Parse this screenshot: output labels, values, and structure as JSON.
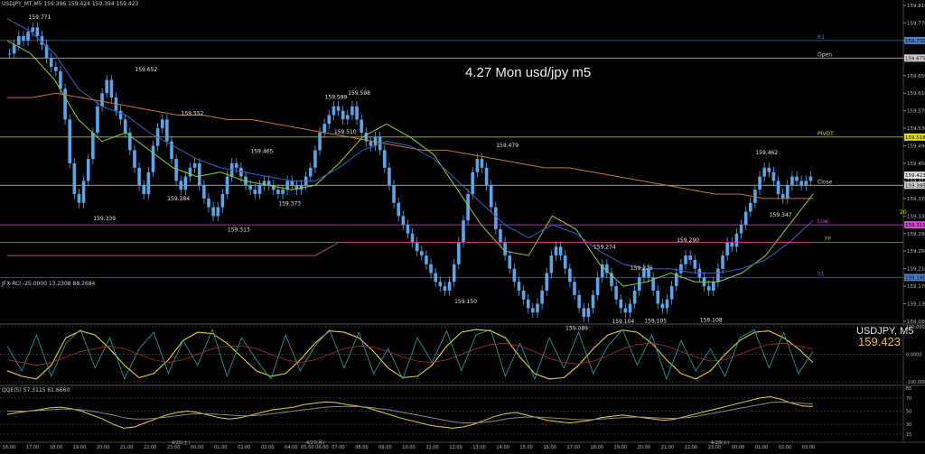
{
  "window": {
    "symbol_header": "USDJPY_MT,M5  159.396 159.424 159.394 159.423",
    "title": "4.27 Mon usd/jpy m5"
  },
  "colors": {
    "background": "#000000",
    "candle": "#5aa6e8",
    "pivot": "#e0e020",
    "r1": "#4d7ec8",
    "s1": "#4d7ec8",
    "open": "#cfcfcf",
    "low": "#d24ad2",
    "pp": "#7ac23a",
    "ma_orange": "#c87a2a",
    "ma_green": "#8ccf3a",
    "ma_blue": "#3a5fc8",
    "ma_pink": "#b0487e",
    "rci_yellow": "#e8d03a",
    "rci_teal": "#2aa6a6",
    "rci_red": "#b03030",
    "qqe_yellow": "#e8d03a"
  },
  "chart_data": [
    {
      "type": "candlestick",
      "title": "4.27 Mon usd/jpy m5",
      "ylim": [
        159.09,
        159.81
      ],
      "y_ticks": [
        "159.810",
        "159.770",
        "159.730",
        "159.690",
        "159.650",
        "159.610",
        "159.570",
        "159.530",
        "159.490",
        "159.450",
        "159.410",
        "159.370",
        "159.330",
        "159.290",
        "159.250",
        "159.210",
        "159.170",
        "159.130",
        "159.090"
      ],
      "x_ticks": [
        "16:00",
        "17:00",
        "18:00",
        "19:00",
        "20:00",
        "21:00",
        "22:00",
        "23:00",
        "00:00",
        "01:00",
        "02:00",
        "03:00",
        "04:00",
        "05:00 06:00",
        "07:00",
        "08:00",
        "09:00",
        "10:00",
        "11:00",
        "12:00",
        "13:00",
        "14:00",
        "15:00",
        "16:00",
        "17:00",
        "18:00",
        "19:00",
        "20:00",
        "21:00",
        "22:00",
        "23:00",
        "00:00",
        "01:00",
        "02:00",
        "03:00"
      ],
      "date_labels": [
        "4/25(土)",
        "4/27(月)",
        "4/28(火)"
      ],
      "levels": [
        {
          "name": "R1",
          "value": 159.73,
          "badge": "159.732"
        },
        {
          "name": "Open",
          "value": 159.69,
          "badge": "159.675"
        },
        {
          "name": "PIVOT",
          "value": 159.51,
          "badge": "159.518"
        },
        {
          "name": "Close",
          "value": 159.4,
          "badge": "159.395"
        },
        {
          "name": "Low",
          "value": 159.31,
          "badge": "159.313"
        },
        {
          "name": "PP",
          "value": 159.27
        },
        {
          "name": "S1",
          "value": 159.19,
          "badge": "159.190"
        }
      ],
      "current_badge": "159.423",
      "right_marker": "20",
      "annotations": [
        {
          "text": "159.771",
          "x": 7,
          "y": 159.771
        },
        {
          "text": "159.652",
          "x": 30,
          "y": 159.652
        },
        {
          "text": "159.552",
          "x": 40,
          "y": 159.552
        },
        {
          "text": "159.339",
          "x": 21,
          "y": 159.339
        },
        {
          "text": "159.384",
          "x": 37,
          "y": 159.384
        },
        {
          "text": "159.313",
          "x": 50,
          "y": 159.313
        },
        {
          "text": "159.465",
          "x": 55,
          "y": 159.465
        },
        {
          "text": "159.373",
          "x": 61,
          "y": 159.373
        },
        {
          "text": "159.589",
          "x": 71,
          "y": 159.589
        },
        {
          "text": "159.598",
          "x": 76,
          "y": 159.598
        },
        {
          "text": "159.510",
          "x": 73,
          "y": 159.51
        },
        {
          "text": "159.479",
          "x": 108,
          "y": 159.479
        },
        {
          "text": "159.150",
          "x": 99,
          "y": 159.15
        },
        {
          "text": "159.274",
          "x": 129,
          "y": 159.274
        },
        {
          "text": "159.089",
          "x": 123,
          "y": 159.089
        },
        {
          "text": "159.226",
          "x": 137,
          "y": 159.226
        },
        {
          "text": "159.104",
          "x": 133,
          "y": 159.104
        },
        {
          "text": "159.105",
          "x": 140,
          "y": 159.105
        },
        {
          "text": "159.290",
          "x": 147,
          "y": 159.29
        },
        {
          "text": "159.108",
          "x": 152,
          "y": 159.108
        },
        {
          "text": "159.462",
          "x": 164,
          "y": 159.462
        },
        {
          "text": "159.347",
          "x": 167,
          "y": 159.347
        }
      ],
      "series": [
        {
          "type": "candle",
          "name": "USDJPY M5",
          "close": [
            159.7,
            159.72,
            159.74,
            159.73,
            159.75,
            159.76,
            159.74,
            159.72,
            159.69,
            159.67,
            159.66,
            159.62,
            159.55,
            159.45,
            159.38,
            159.36,
            159.41,
            159.46,
            159.52,
            159.58,
            159.61,
            159.64,
            159.6,
            159.57,
            159.55,
            159.52,
            159.48,
            159.44,
            159.4,
            159.38,
            159.43,
            159.49,
            159.53,
            159.55,
            159.5,
            159.46,
            159.41,
            159.39,
            159.42,
            159.44,
            159.45,
            159.4,
            159.37,
            159.35,
            159.33,
            159.35,
            159.38,
            159.42,
            159.45,
            159.44,
            159.42,
            159.4,
            159.39,
            159.38,
            159.4,
            159.41,
            159.4,
            159.39,
            159.38,
            159.39,
            159.41,
            159.4,
            159.39,
            159.4,
            159.42,
            159.44,
            159.48,
            159.52,
            159.54,
            159.56,
            159.58,
            159.57,
            159.55,
            159.56,
            159.58,
            159.55,
            159.52,
            159.5,
            159.49,
            159.51,
            159.48,
            159.44,
            159.4,
            159.36,
            159.33,
            159.31,
            159.29,
            159.27,
            159.25,
            159.24,
            159.22,
            159.2,
            159.18,
            159.17,
            159.16,
            159.18,
            159.22,
            159.27,
            159.32,
            159.38,
            159.43,
            159.46,
            159.44,
            159.4,
            159.35,
            159.3,
            159.27,
            159.24,
            159.21,
            159.18,
            159.16,
            159.14,
            159.12,
            159.11,
            159.13,
            159.16,
            159.2,
            159.24,
            159.26,
            159.24,
            159.21,
            159.18,
            159.15,
            159.12,
            159.1,
            159.12,
            159.15,
            159.19,
            159.22,
            159.2,
            159.17,
            159.14,
            159.12,
            159.11,
            159.13,
            159.16,
            159.19,
            159.21,
            159.19,
            159.16,
            159.13,
            159.12,
            159.14,
            159.17,
            159.2,
            159.22,
            159.24,
            159.23,
            159.21,
            159.19,
            159.17,
            159.16,
            159.18,
            159.21,
            159.24,
            159.27,
            159.26,
            159.29,
            159.31,
            159.34,
            159.36,
            159.39,
            159.42,
            159.44,
            159.43,
            159.41,
            159.38,
            159.37,
            159.4,
            159.42,
            159.41,
            159.4,
            159.41,
            159.42
          ]
        },
        {
          "type": "line",
          "name": "MA orange",
          "values": [
            159.6,
            159.6,
            159.61,
            159.6,
            159.59,
            159.58,
            159.57,
            159.56,
            159.56,
            159.55,
            159.55,
            159.54,
            159.53,
            159.52,
            159.51,
            159.5,
            159.49,
            159.48,
            159.48,
            159.47,
            159.46,
            159.45,
            159.44,
            159.44,
            159.43,
            159.42,
            159.41,
            159.4,
            159.39,
            159.38,
            159.38,
            159.37,
            159.37,
            159.37
          ]
        },
        {
          "type": "line",
          "name": "MA green",
          "values": [
            159.73,
            159.7,
            159.64,
            159.55,
            159.5,
            159.52,
            159.48,
            159.44,
            159.42,
            159.43,
            159.41,
            159.4,
            159.39,
            159.4,
            159.45,
            159.51,
            159.54,
            159.51,
            159.47,
            159.39,
            159.31,
            159.25,
            159.24,
            159.33,
            159.3,
            159.22,
            159.17,
            159.18,
            159.2,
            159.18,
            159.18,
            159.2,
            159.24,
            159.31,
            159.38
          ]
        },
        {
          "type": "line",
          "name": "MA blue",
          "values": [
            159.78,
            159.75,
            159.7,
            159.62,
            159.58,
            159.56,
            159.52,
            159.49,
            159.46,
            159.44,
            159.43,
            159.42,
            159.41,
            159.41,
            159.44,
            159.48,
            159.5,
            159.49,
            159.46,
            159.41,
            159.36,
            159.31,
            159.28,
            159.31,
            159.29,
            159.25,
            159.22,
            159.21,
            159.21,
            159.2,
            159.2,
            159.21,
            159.23,
            159.27,
            159.32
          ]
        },
        {
          "type": "line",
          "name": "MA pink",
          "values": [
            159.24,
            159.24,
            159.24,
            159.24,
            159.24,
            159.24,
            159.24,
            159.24,
            159.24,
            159.24,
            159.24,
            159.24,
            159.24,
            159.24,
            159.27,
            159.27,
            159.27,
            159.27,
            159.27,
            159.27,
            159.27,
            159.27,
            159.27,
            159.27,
            159.27,
            159.27,
            159.27,
            159.27,
            159.27,
            159.27,
            159.27,
            159.27,
            159.27,
            159.27,
            159.27
          ]
        }
      ]
    },
    {
      "type": "line",
      "label": "JFX-RCI -25.0000 13.2308 88.2684",
      "symbol_label": "USDJPY, M5",
      "price_label": "159.423",
      "y_ticks": [
        "100.0000",
        "0.0000",
        "-100.0000"
      ],
      "ylim": [
        -100,
        100
      ],
      "series": [
        {
          "name": "RCI yellow",
          "values": [
            -60,
            -80,
            -90,
            -40,
            60,
            85,
            70,
            20,
            -40,
            -85,
            -70,
            -20,
            50,
            80,
            75,
            40,
            -10,
            -60,
            -80,
            -70,
            -20,
            40,
            85,
            80,
            60,
            10,
            -50,
            -85,
            -80,
            -40,
            30,
            80,
            90,
            85,
            60,
            -10,
            -70,
            -90,
            -85,
            -40,
            20,
            70,
            88,
            80,
            40,
            -20,
            -70,
            -90,
            -60,
            0,
            50,
            80,
            85,
            60,
            20,
            -30
          ]
        },
        {
          "name": "RCI teal",
          "values": [
            30,
            -60,
            70,
            -80,
            40,
            90,
            -50,
            60,
            -90,
            20,
            80,
            -70,
            50,
            -40,
            90,
            -80,
            60,
            -20,
            -90,
            70,
            -60,
            30,
            90,
            -50,
            80,
            -70,
            20,
            -90,
            60,
            -30,
            85,
            -60,
            70,
            90,
            -80,
            40,
            -90,
            60,
            -50,
            80,
            -70,
            30,
            90,
            -40,
            70,
            -90,
            50,
            -60,
            20,
            -80,
            60,
            90,
            -50,
            80,
            -70,
            10
          ]
        },
        {
          "name": "RCI red",
          "values": [
            -20,
            -30,
            -40,
            -30,
            -10,
            10,
            20,
            30,
            20,
            0,
            -20,
            -30,
            -20,
            0,
            20,
            30,
            30,
            20,
            0,
            -20,
            -30,
            -20,
            0,
            20,
            30,
            25,
            10,
            -10,
            -25,
            -30,
            -20,
            0,
            20,
            35,
            40,
            30,
            10,
            -15,
            -30,
            -35,
            -25,
            -5,
            20,
            35,
            40,
            30,
            10,
            -10,
            -25,
            -20,
            0,
            20,
            35,
            40,
            30,
            20
          ]
        }
      ]
    },
    {
      "type": "line",
      "label": "QQE(5) 57.3115 61.6660",
      "y_ticks": [
        "85",
        "70",
        "50",
        "30",
        "15"
      ],
      "ylim": [
        15,
        85
      ],
      "series": [
        {
          "name": "QQE yellow",
          "values": [
            45,
            48,
            50,
            52,
            55,
            56,
            54,
            50,
            44,
            38,
            30,
            24,
            26,
            32,
            38,
            44,
            48,
            50,
            48,
            44,
            40,
            38,
            40,
            44,
            48,
            52,
            54,
            56,
            60,
            62,
            64,
            63,
            60,
            58,
            55,
            50,
            45,
            40,
            36,
            32,
            28,
            26,
            24,
            26,
            30,
            36,
            42,
            46,
            48,
            44,
            40,
            36,
            34,
            32,
            34,
            36,
            40,
            42,
            44,
            42,
            40,
            38,
            36,
            38,
            42,
            46,
            50,
            54,
            58,
            62,
            66,
            70,
            72,
            68,
            62,
            58,
            57
          ]
        },
        {
          "name": "QQE gray",
          "values": [
            50,
            50,
            50,
            51,
            52,
            53,
            53,
            52,
            50,
            47,
            44,
            40,
            38,
            38,
            39,
            41,
            43,
            45,
            46,
            46,
            45,
            44,
            43,
            43,
            44,
            46,
            48,
            50,
            52,
            54,
            56,
            57,
            57,
            57,
            56,
            54,
            52,
            49,
            46,
            43,
            40,
            37,
            34,
            32,
            32,
            33,
            35,
            38,
            40,
            41,
            41,
            40,
            39,
            38,
            37,
            37,
            38,
            39,
            40,
            41,
            41,
            40,
            39,
            39,
            40,
            42,
            45,
            48,
            51,
            54,
            57,
            60,
            63,
            64,
            63,
            62,
            61
          ]
        }
      ]
    }
  ]
}
